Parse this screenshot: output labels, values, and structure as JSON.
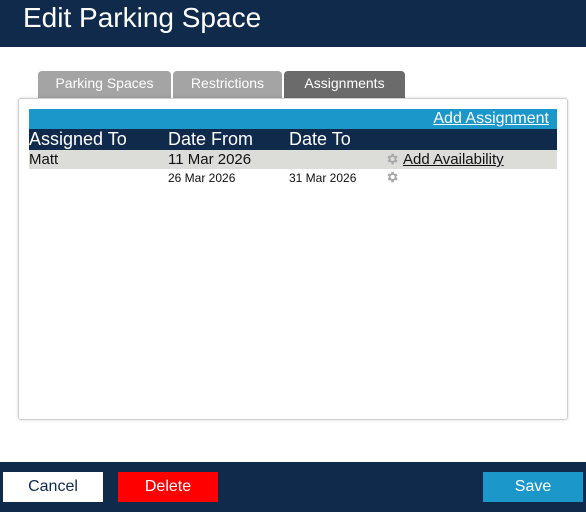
{
  "header": {
    "title": "Edit Parking Space"
  },
  "tabs": [
    {
      "label": "Parking Spaces",
      "active": false
    },
    {
      "label": "Restrictions",
      "active": false
    },
    {
      "label": "Assignments",
      "active": true
    }
  ],
  "assignments": {
    "add_label": "Add Assignment",
    "columns": [
      "Assigned To",
      "Date From",
      "Date To"
    ],
    "rows": [
      {
        "assigned_to": "Matt",
        "date_from": "11 Mar 2026",
        "date_to": "",
        "action_icon": "gear-icon",
        "action_label": "Add Availability"
      },
      {
        "assigned_to": "",
        "date_from": "26 Mar 2026",
        "date_to": "31 Mar 2026",
        "action_icon": "gear-icon"
      }
    ]
  },
  "footer": {
    "cancel_label": "Cancel",
    "delete_label": "Delete",
    "save_label": "Save"
  },
  "colors": {
    "navy": "#102a4c",
    "accent_blue": "#1c97c9",
    "delete_red": "#ff0000",
    "tab_inactive": "#a4a4a4",
    "tab_active": "#6b6b6b",
    "row_highlight": "#dcdcd8"
  }
}
